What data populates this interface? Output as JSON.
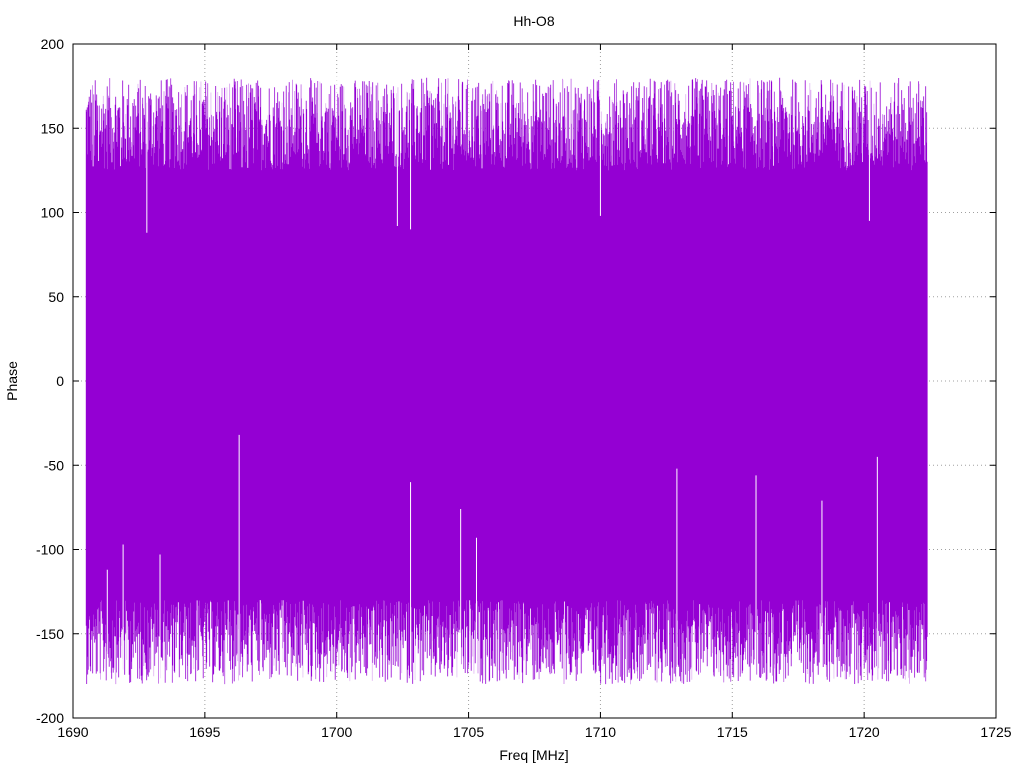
{
  "chart_data": {
    "type": "line",
    "title": "Hh-O8",
    "xlabel": "Freq [MHz]",
    "ylabel": "Phase",
    "xlim": [
      1690,
      1725
    ],
    "ylim": [
      -200,
      200
    ],
    "xticks": [
      1690,
      1695,
      1700,
      1705,
      1710,
      1715,
      1720,
      1725
    ],
    "yticks": [
      -200,
      -150,
      -100,
      -50,
      0,
      50,
      100,
      150,
      200
    ],
    "grid": true,
    "line_color": "#9400d3",
    "series": [
      {
        "x_range": [
          1690.5,
          1722.4
        ],
        "y_envelope": [
          -180,
          180
        ],
        "dense_wrapped_phase": true,
        "notable_upper_dips": [
          {
            "x": 1692.8,
            "y": 88
          },
          {
            "x": 1702.3,
            "y": 92
          },
          {
            "x": 1702.8,
            "y": 90
          },
          {
            "x": 1710.0,
            "y": 98
          },
          {
            "x": 1720.2,
            "y": 95
          }
        ],
        "notable_lower_spikes": [
          {
            "x": 1691.3,
            "y": -112
          },
          {
            "x": 1691.9,
            "y": -97
          },
          {
            "x": 1693.3,
            "y": -103
          },
          {
            "x": 1696.3,
            "y": -32
          },
          {
            "x": 1697.1,
            "y": -130
          },
          {
            "x": 1702.8,
            "y": -60
          },
          {
            "x": 1704.7,
            "y": -76
          },
          {
            "x": 1705.3,
            "y": -93
          },
          {
            "x": 1712.9,
            "y": -52
          },
          {
            "x": 1715.9,
            "y": -56
          },
          {
            "x": 1718.4,
            "y": -71
          },
          {
            "x": 1720.5,
            "y": -45
          }
        ]
      }
    ]
  }
}
